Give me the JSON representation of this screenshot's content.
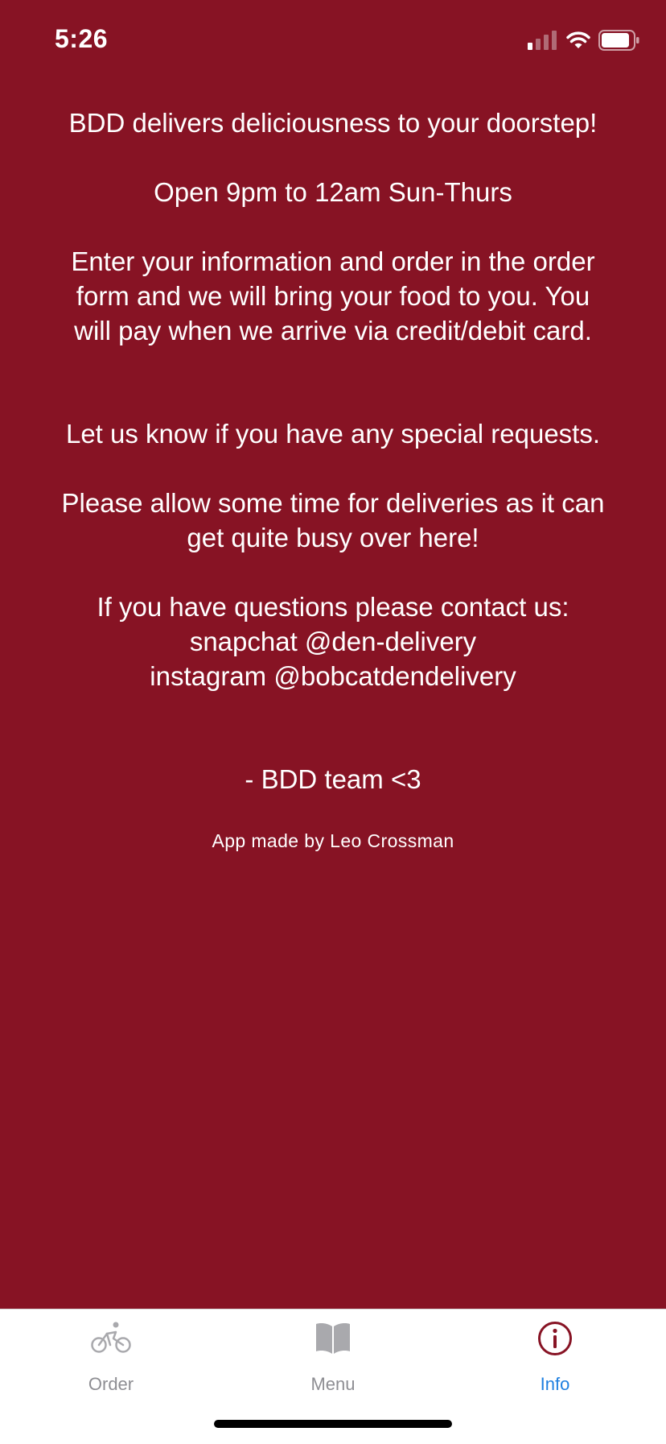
{
  "status_bar": {
    "time": "5:26",
    "icons": [
      "cellular-signal-icon",
      "wifi-icon",
      "battery-icon"
    ]
  },
  "info": {
    "lines": [
      "BDD delivers deliciousness to your doorstep!",
      "Open 9pm to 12am Sun-Thurs",
      "Enter your information and order in the order",
      "form and we will bring your food to you. You",
      "will pay when we arrive via credit/debit card.",
      "Let us know if you have any special requests.",
      "Please allow some time for deliveries as it can",
      "get quite busy over here!",
      "If you have questions please contact us:",
      "snapchat @den-delivery",
      "instagram @bobcatdendelivery",
      "- BDD team <3"
    ],
    "credit": "App made by Leo Crossman"
  },
  "tab_bar": {
    "tabs": [
      {
        "label": "Order",
        "icon": "bicycle-icon",
        "active": false
      },
      {
        "label": "Menu",
        "icon": "book-icon",
        "active": false
      },
      {
        "label": "Info",
        "icon": "info-circle-icon",
        "active": true
      }
    ]
  },
  "colors": {
    "background": "#871324",
    "text": "#ffffff",
    "tab_inactive": "#8e8e93",
    "tab_active_label": "#1e7fe0",
    "tab_active_icon": "#871324"
  }
}
